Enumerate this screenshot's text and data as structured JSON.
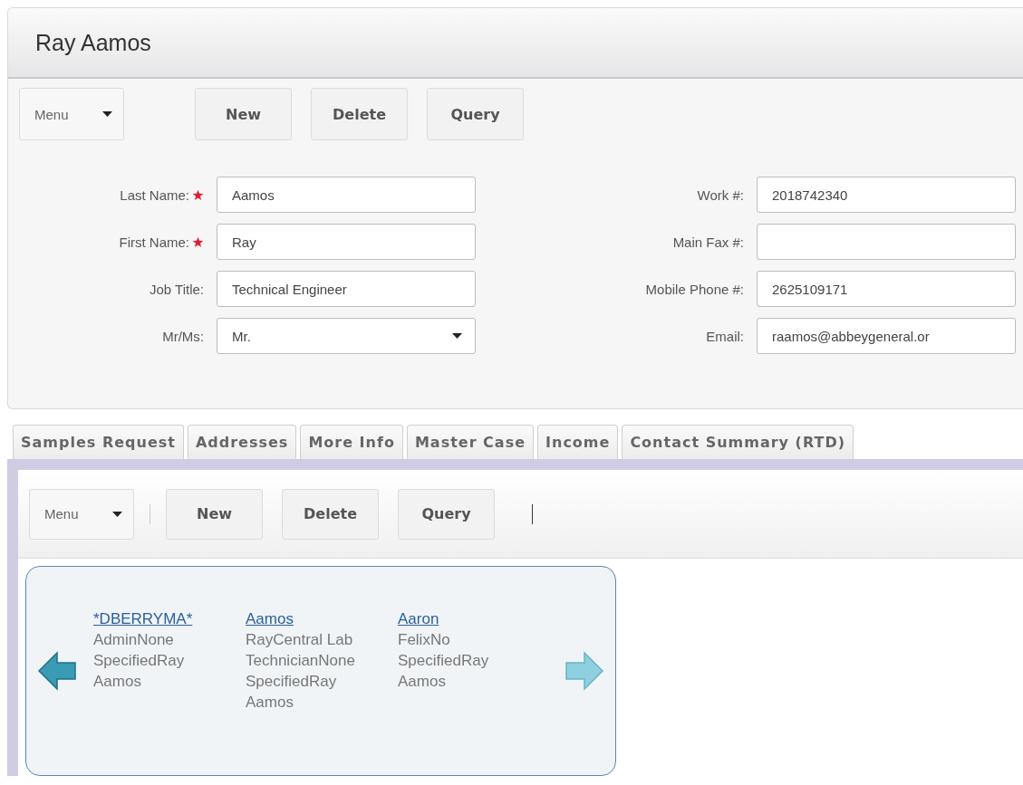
{
  "title": "Ray Aamos",
  "toolbar": {
    "menu": "Menu",
    "buttons": [
      "New",
      "Delete",
      "Query"
    ]
  },
  "form": {
    "left": [
      {
        "label": "Last Name:",
        "required": true,
        "kind": "text",
        "value": "Aamos"
      },
      {
        "label": "First Name:",
        "required": true,
        "kind": "text",
        "value": "Ray"
      },
      {
        "label": "Job Title:",
        "required": false,
        "kind": "text",
        "value": "Technical Engineer"
      },
      {
        "label": "Mr/Ms:",
        "required": false,
        "kind": "select",
        "value": "Mr."
      }
    ],
    "right": [
      {
        "label": "Work #:",
        "required": false,
        "kind": "text",
        "value": "2018742340"
      },
      {
        "label": "Main Fax #:",
        "required": false,
        "kind": "text"
      },
      {
        "label": "Mobile Phone #:",
        "required": false,
        "kind": "text",
        "value": "2625109171"
      },
      {
        "label": "Email:",
        "required": false,
        "kind": "text",
        "value": "raamos@abbeygeneral.or"
      }
    ]
  },
  "tabs": [
    {
      "label": "Samples Request",
      "selected": false
    },
    {
      "label": "Addresses",
      "selected": false
    },
    {
      "label": "More Info",
      "selected": false
    },
    {
      "label": "Master Case",
      "selected": false
    },
    {
      "label": "Income",
      "selected": false
    },
    {
      "label": "Contact Summary (RTD)",
      "selected": false
    }
  ],
  "sub_toolbar": {
    "menu": "Menu",
    "buttons": [
      "New",
      "Delete",
      "Query"
    ]
  },
  "carousel": {
    "prev_disabled": false,
    "next_disabled": true,
    "cards": [
      {
        "link": "*DBERRYMA*",
        "text": "AdminNone SpecifiedRay Aamos"
      },
      {
        "link": "Aamos",
        "text": "RayCentral Lab TechnicianNone SpecifiedRay Aamos"
      },
      {
        "link": "Aaron",
        "text": "FelixNo SpecifiedRay Aamos"
      }
    ]
  }
}
